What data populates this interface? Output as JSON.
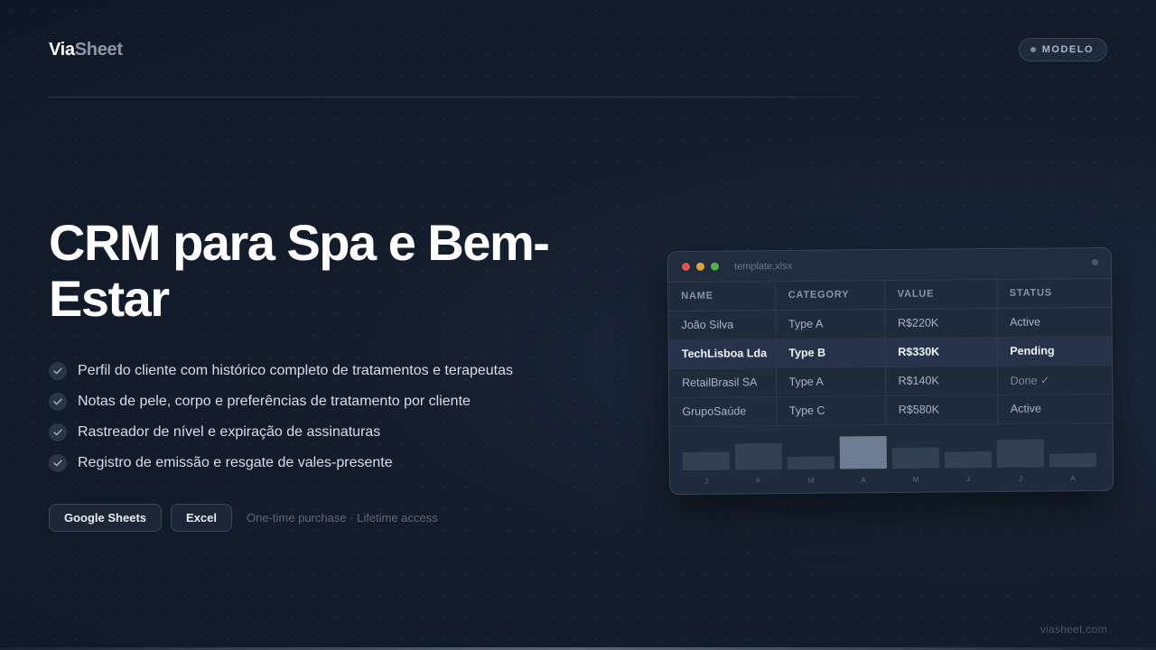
{
  "brand": {
    "name_part1": "Via",
    "name_part2": "Sheet"
  },
  "badge": {
    "label": "MODELO"
  },
  "hero": {
    "title": "CRM para Spa e Bem-Estar"
  },
  "features": [
    "Perfil do cliente com histórico completo de tratamentos e terapeutas",
    "Notas de pele, corpo e preferências de tratamento por cliente",
    "Rastreador de nível e expiração de assinaturas",
    "Registro de emissão e resgate de vales-presente"
  ],
  "actions": {
    "google_sheets_label": "Google Sheets",
    "excel_label": "Excel",
    "purchase_note": "One-time purchase · Lifetime access"
  },
  "footer": {
    "url": "viasheet.com"
  },
  "preview": {
    "filename": "template.xlsx",
    "columns": [
      "NAME",
      "CATEGORY",
      "VALUE",
      "STATUS"
    ],
    "rows": [
      [
        "João Silva",
        "Type A",
        "R$220K",
        "Active"
      ],
      [
        "TechLisboa Lda",
        "Type B",
        "R$330K",
        "Pending"
      ],
      [
        "RetailBrasil SA",
        "Type A",
        "R$140K",
        "Done ✓"
      ],
      [
        "GrupoSaúde",
        "Type C",
        "R$580K",
        "Active"
      ]
    ],
    "highlighted_row": 1,
    "chart": {
      "labels": [
        "J",
        "F",
        "M",
        "A",
        "M",
        "J",
        "J",
        "A"
      ],
      "values": [
        0.55,
        0.8,
        0.4,
        1.0,
        0.65,
        0.5,
        0.85,
        0.42
      ],
      "active_index": 3
    }
  },
  "colors": {
    "traffic_red": "#e0524e",
    "traffic_yellow": "#dfa23a",
    "traffic_green": "#4fb04d"
  }
}
